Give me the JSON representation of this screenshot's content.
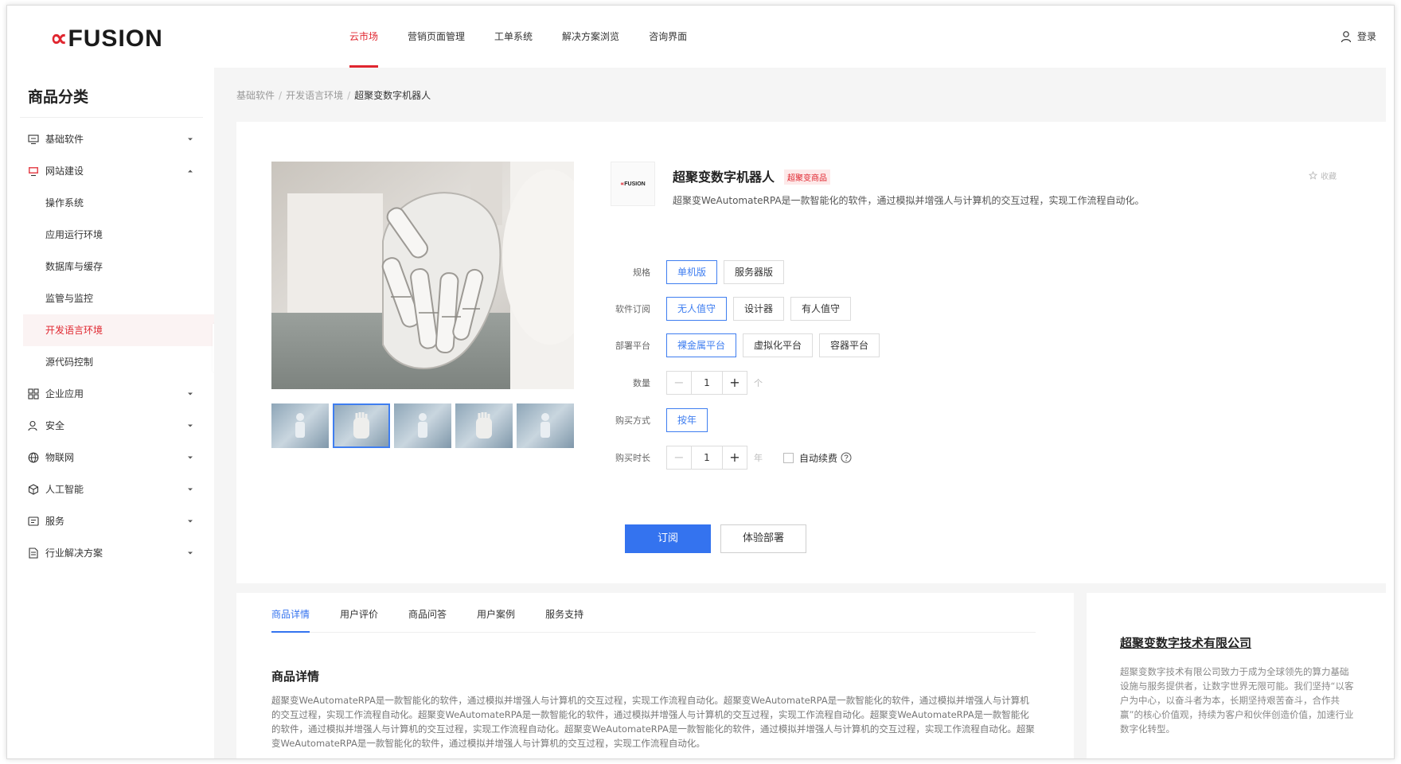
{
  "header": {
    "logo_prefix": "∝",
    "logo_text": "FUSION",
    "nav": [
      "云市场",
      "营销页面管理",
      "工单系统",
      "解决方案浏览",
      "咨询界面"
    ],
    "login_label": "登录"
  },
  "sidebar": {
    "title": "商品分类",
    "items": [
      {
        "label": "基础软件",
        "icon": "monitor-icon"
      },
      {
        "label": "网站建设",
        "icon": "website-icon"
      },
      {
        "label": "操作系统"
      },
      {
        "label": "应用运行环境"
      },
      {
        "label": "数据库与缓存"
      },
      {
        "label": "监管与监控"
      },
      {
        "label": "开发语言环境"
      },
      {
        "label": "源代码控制"
      },
      {
        "label": "企业应用",
        "icon": "grid-icon"
      },
      {
        "label": "安全",
        "icon": "person-icon"
      },
      {
        "label": "物联网",
        "icon": "globe-icon"
      },
      {
        "label": "人工智能",
        "icon": "cube-icon"
      },
      {
        "label": "服务",
        "icon": "service-icon"
      },
      {
        "label": "行业解决方案",
        "icon": "document-icon"
      }
    ]
  },
  "breadcrumb": {
    "level1": "基础软件",
    "level2": "开发语言环境",
    "current": "超聚变数字机器人",
    "separator": "/"
  },
  "product": {
    "brand_logo_prefix": "∝",
    "brand_logo_text": "FUSION",
    "title": "超聚变数字机器人",
    "badge": "超聚变商品",
    "favorite_label": "收藏",
    "description": "超聚变WeAutomateRPA是一款智能化的软件，通过模拟并增强人与计算机的交互过程，实现工作流程自动化。",
    "spec": {
      "label": "规格",
      "options": [
        "单机版",
        "服务器版"
      ]
    },
    "subscription": {
      "label": "软件订阅",
      "options": [
        "无人值守",
        "设计器",
        "有人值守"
      ]
    },
    "platform": {
      "label": "部署平台",
      "options": [
        "裸金属平台",
        "虚拟化平台",
        "容器平台"
      ]
    },
    "quantity": {
      "label": "数量",
      "value": "1",
      "minus": "−",
      "plus": "+",
      "unit": "个"
    },
    "purchase_mode": {
      "label": "购买方式",
      "option": "按年"
    },
    "duration": {
      "label": "购买时长",
      "value": "1",
      "minus": "−",
      "plus": "+",
      "unit": "年",
      "auto_renew_label": "自动续费"
    },
    "subscribe_button": "订阅",
    "trial_button": "体验部署"
  },
  "detail": {
    "tabs": [
      "商品详情",
      "用户评价",
      "商品问答",
      "用户案例",
      "服务支持"
    ],
    "title": "商品详情",
    "text": "超聚变WeAutomateRPA是一款智能化的软件，通过模拟并增强人与计算机的交互过程，实现工作流程自动化。超聚变WeAutomateRPA是一款智能化的软件，通过模拟并增强人与计算机的交互过程，实现工作流程自动化。超聚变WeAutomateRPA是一款智能化的软件，通过模拟并增强人与计算机的交互过程，实现工作流程自动化。超聚变WeAutomateRPA是一款智能化的软件，通过模拟并增强人与计算机的交互过程，实现工作流程自动化。超聚变WeAutomateRPA是一款智能化的软件，通过模拟并增强人与计算机的交互过程，实现工作流程自动化。超聚变WeAutomateRPA是一款智能化的软件，通过模拟并增强人与计算机的交互过程，实现工作流程自动化。"
  },
  "company": {
    "name": "超聚变数字技术有限公司",
    "description": "超聚变数字技术有限公司致力于成为全球领先的算力基础设施与服务提供者，让数字世界无限可能。我们坚持“以客户为中心，以奋斗者为本，长期坚持艰苦奋斗，合作共赢”的核心价值观，持续为客户和伙伴创造价值，加速行业数字化转型。"
  },
  "colors": {
    "brand_red": "#e0262f",
    "primary_blue": "#3473ef",
    "page_bg": "#f5f5f5"
  }
}
